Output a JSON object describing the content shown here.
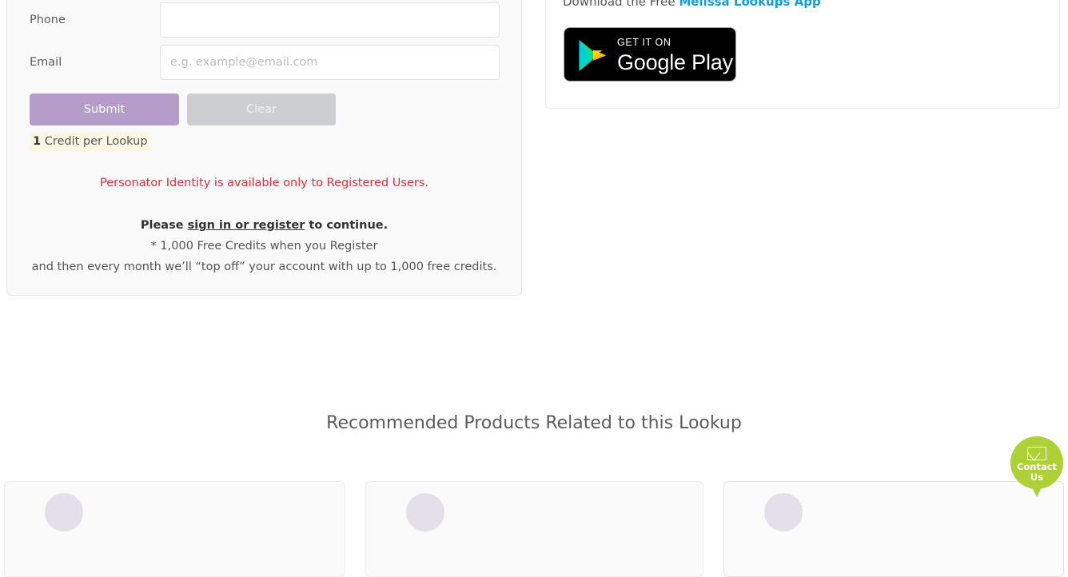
{
  "form": {
    "fields": [
      {
        "label": "Phone",
        "value": "",
        "placeholder": ""
      },
      {
        "label": "Email",
        "value": "",
        "placeholder": "e.g. example@email.com"
      }
    ],
    "submit_label": "Submit",
    "clear_label": "Clear",
    "credit_badge": {
      "count": "1",
      "text": " Credit per Lookup"
    },
    "notice": "Personator Identity is available only to Registered Users.",
    "signin": {
      "prefix": "Please ",
      "link": "sign in or register",
      "suffix": " to continue.",
      "line2": "* 1,000 Free Credits when you Register",
      "line3": "and then every month we’ll “top off” your account with up to 1,000 free credits."
    },
    "colors": {
      "submit": "#b69cc9",
      "clear": "#ccced2",
      "notice": "#e0303a",
      "badge_bg": "#fdf6e3"
    }
  },
  "app_panel": {
    "text_prefix": "Download the Free ",
    "link_label": "Melissa Lookups App",
    "link_color": "#119fdc",
    "badge": {
      "name": "google-play-badge",
      "top_line": "GET IT ON",
      "main_line": "Google Play"
    }
  },
  "recommended": {
    "title": "Recommended Products Related to this Lookup",
    "cards": [
      {
        "name": "product-card-1"
      },
      {
        "name": "product-card-2"
      },
      {
        "name": "product-card-3"
      }
    ]
  },
  "contact_widget": {
    "line1": "Contact",
    "line2": "Us",
    "color": "#aed136",
    "icon": "envelope-icon"
  }
}
